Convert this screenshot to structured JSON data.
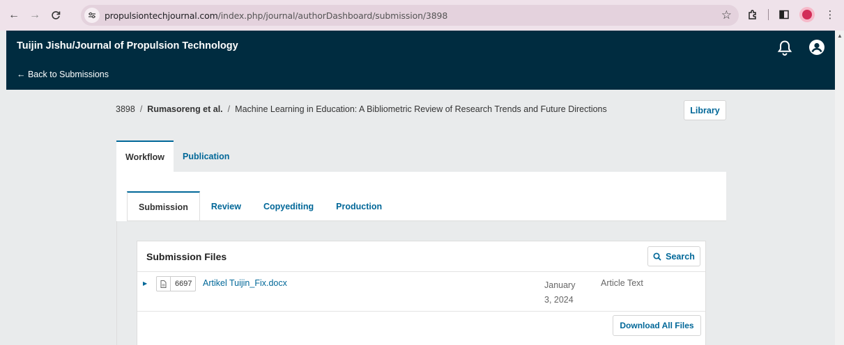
{
  "browser": {
    "url_host": "propulsiontechjournal.com",
    "url_path": "/index.php/journal/authorDashboard/submission/3898",
    "icons": [
      "back-arrow-icon",
      "forward-arrow-icon",
      "reload-icon",
      "site-info-icon",
      "star-icon",
      "extensions-icon",
      "side-panel-icon",
      "profile-icon",
      "menu-icon"
    ]
  },
  "header": {
    "journal_title": "Tuijin Jishu/Journal of Propulsion Technology",
    "back_link": "← Back to Submissions"
  },
  "breadcrumb": {
    "id": "3898",
    "separator": "/",
    "author": "Rumasoreng et al.",
    "title": "Machine Learning in Education: A Bibliometric Review of Research Trends and Future Directions"
  },
  "library_label": "Library",
  "main_tabs": [
    {
      "label": "Workflow",
      "active": true
    },
    {
      "label": "Publication",
      "active": false
    }
  ],
  "sub_tabs": [
    {
      "label": "Submission",
      "active": true
    },
    {
      "label": "Review",
      "active": false
    },
    {
      "label": "Copyediting",
      "active": false
    },
    {
      "label": "Production",
      "active": false
    }
  ],
  "files": {
    "title": "Submission Files",
    "search_label": "Search",
    "rows": [
      {
        "id": "6697",
        "name": "Artikel Tuijin_Fix.docx",
        "date": "January 3, 2024",
        "type": "Article Text"
      }
    ],
    "download_label": "Download All Files"
  },
  "colors": {
    "header_bg": "#002c40",
    "link": "#006798",
    "page_bg": "#e9ebec",
    "chrome_bg": "#efe2ea"
  }
}
